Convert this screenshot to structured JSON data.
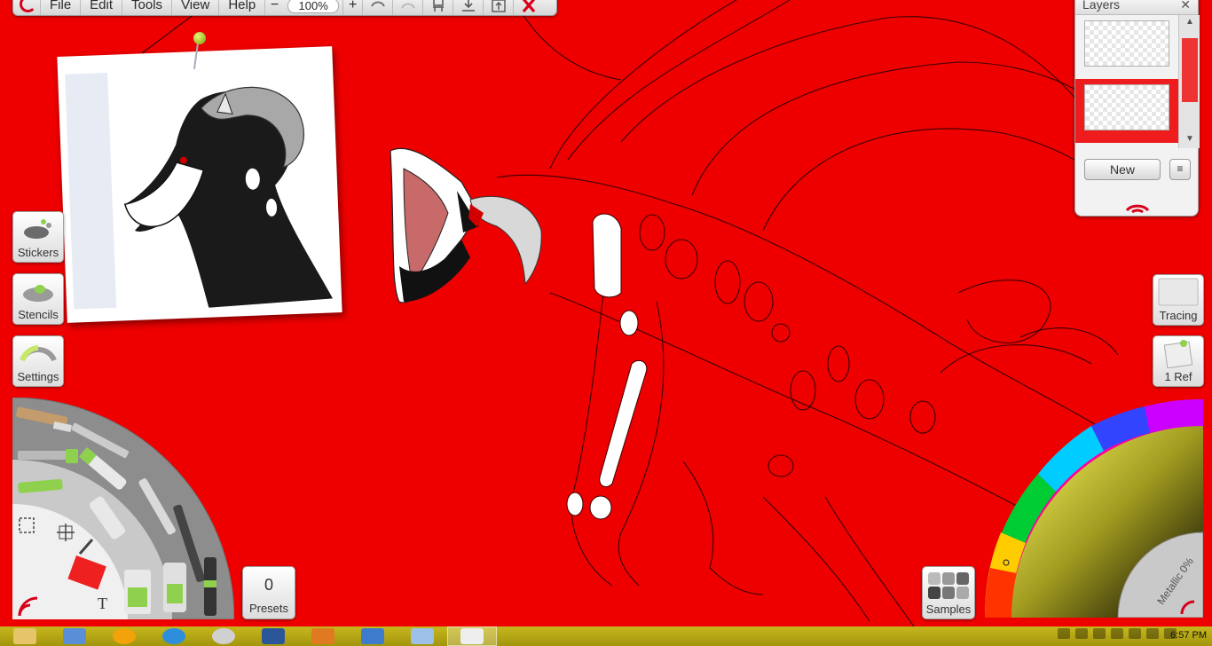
{
  "menubar": {
    "items": [
      "File",
      "Edit",
      "Tools",
      "View",
      "Help"
    ],
    "zoom_minus": "−",
    "zoom_value": "100%",
    "zoom_plus": "+"
  },
  "left_buttons": {
    "stickers": "Stickers",
    "stencils": "Stencils",
    "settings": "Settings"
  },
  "presets": {
    "count": "0",
    "label": "Presets"
  },
  "samples": {
    "label": "Samples"
  },
  "right_buttons": {
    "tracing": "Tracing",
    "ref": "1 Ref"
  },
  "layers": {
    "title": "Layers",
    "close": "✕",
    "new_button": "New",
    "menu_button": "≡"
  },
  "color_wheel": {
    "metallic_label": "Metallic 0%"
  },
  "tool_wheel": {
    "text_tool": "T"
  },
  "taskbar": {
    "time": "6:57 PM"
  },
  "colors": {
    "canvas": "#ee0000",
    "accent": "#d8001a",
    "taskbar": "#b8a915"
  }
}
